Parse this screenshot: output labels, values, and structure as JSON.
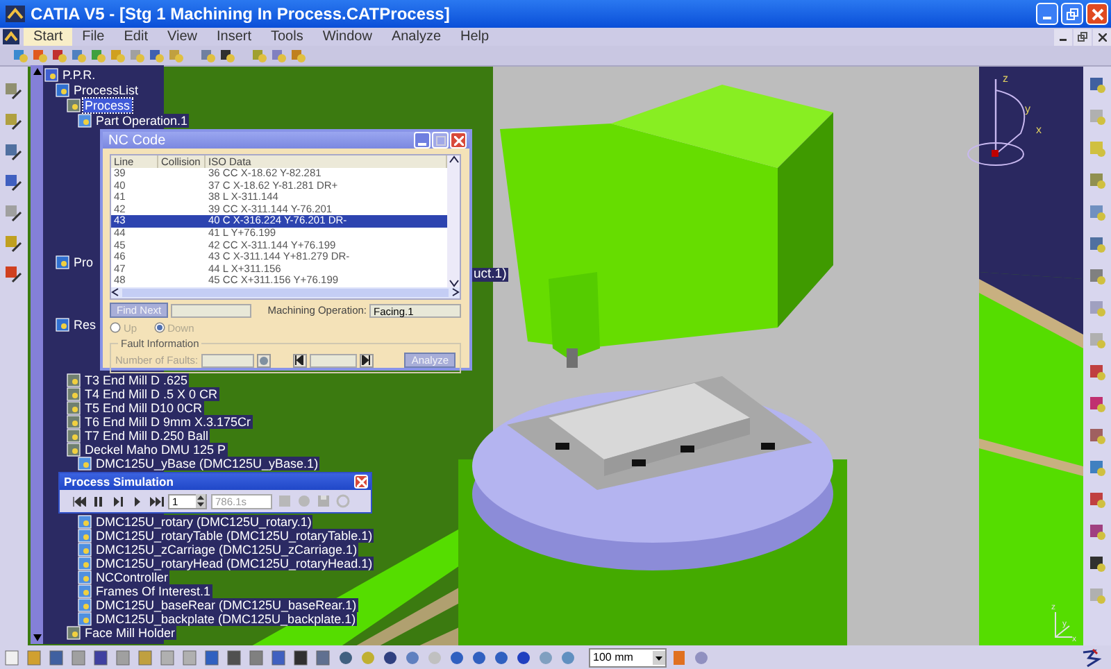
{
  "window": {
    "title": "CATIA V5 - [Stg 1 Machining In Process.CATProcess]"
  },
  "menu": [
    {
      "label": "Start",
      "selected": true
    },
    {
      "label": "File",
      "selected": false
    },
    {
      "label": "Edit",
      "selected": false
    },
    {
      "label": "View",
      "selected": false
    },
    {
      "label": "Insert",
      "selected": false
    },
    {
      "label": "Tools",
      "selected": false
    },
    {
      "label": "Window",
      "selected": false
    },
    {
      "label": "Analyze",
      "selected": false
    },
    {
      "label": "Help",
      "selected": false
    }
  ],
  "tree": {
    "items": [
      {
        "label": "P.P.R.",
        "selected": false,
        "children": [
          {
            "label": "ProcessList",
            "selected": false,
            "children": [
              {
                "label": "Process",
                "selected": true,
                "children": [
                  {
                    "label": "Part Operation.1",
                    "selected": false
                  }
                ]
              }
            ]
          },
          {
            "label": "Pro",
            "selected": false
          },
          {
            "label": "Res",
            "selected": false,
            "children": [
              {
                "label": "T3 End Mill D .625",
                "selected": false
              },
              {
                "label": "T4 End Mill D .5 X 0 CR",
                "selected": false
              },
              {
                "label": "T5 End Mill D10 0CR",
                "selected": false
              },
              {
                "label": "T6 End Mill D 9mm X.3.175Cr",
                "selected": false
              },
              {
                "label": "T7 End Mill D.250 Ball",
                "selected": false
              },
              {
                "label": "Deckel Maho DMU 125 P",
                "selected": false,
                "children": [
                  {
                    "label": "DMC125U_yBase (DMC125U_yBase.1)",
                    "selected": false
                  },
                  {
                    "label": "DMC125U_rotary (DMC125U_rotary.1)",
                    "selected": false
                  },
                  {
                    "label": "DMC125U_rotaryTable (DMC125U_rotaryTable.1)",
                    "selected": false
                  },
                  {
                    "label": "DMC125U_zCarriage (DMC125U_zCarriage.1)",
                    "selected": false
                  },
                  {
                    "label": "DMC125U_rotaryHead (DMC125U_rotaryHead.1)",
                    "selected": false
                  },
                  {
                    "label": "NCController",
                    "selected": false
                  },
                  {
                    "label": "Frames Of Interest.1",
                    "selected": false
                  },
                  {
                    "label": "DMC125U_baseRear (DMC125U_baseRear.1)",
                    "selected": false
                  },
                  {
                    "label": "DMC125U_backplate (DMC125U_backplate.1)",
                    "selected": false
                  }
                ]
              },
              {
                "label": "Face Mill Holder",
                "selected": false
              }
            ]
          }
        ]
      }
    ]
  },
  "tree_fragment": "uct.1)",
  "nc_code": {
    "title": "NC Code",
    "columns": [
      "Line",
      "Collision",
      "ISO Data"
    ],
    "rows": [
      {
        "line": "39",
        "iso": "36 CC X-18.62 Y-82.281",
        "selected": false
      },
      {
        "line": "40",
        "iso": "37 C X-18.62 Y-81.281 DR+",
        "selected": false
      },
      {
        "line": "41",
        "iso": "38 L X-311.144",
        "selected": false
      },
      {
        "line": "42",
        "iso": "39 CC X-311.144 Y-76.201",
        "selected": false
      },
      {
        "line": "43",
        "iso": "40 C X-316.224 Y-76.201 DR-",
        "selected": true
      },
      {
        "line": "44",
        "iso": "41 L Y+76.199",
        "selected": false
      },
      {
        "line": "45",
        "iso": "42 CC X-311.144 Y+76.199",
        "selected": false
      },
      {
        "line": "46",
        "iso": "43 C X-311.144 Y+81.279 DR-",
        "selected": false
      },
      {
        "line": "47",
        "iso": "44 L X+311.156",
        "selected": false
      },
      {
        "line": "48",
        "iso": "45 CC X+311.156 Y+76.199",
        "selected": false
      }
    ],
    "find_button": {
      "label": "Find Next",
      "disabled": true
    },
    "machining_label": "Machining Operation:",
    "machining_value": "Facing.1",
    "direction": [
      {
        "label": "Up",
        "selected": false
      },
      {
        "label": "Down",
        "selected": true
      }
    ],
    "fault_group": "Fault Information",
    "faults_label": "Number of Faults:",
    "analyze_button": {
      "label": "Analyze",
      "disabled": true
    }
  },
  "simulation": {
    "title": "Process Simulation",
    "step": "1",
    "time": "786.1s"
  },
  "bottom_toolbar": {
    "scale": "100 mm"
  },
  "compass": {
    "axes": [
      "z",
      "y",
      "x"
    ]
  },
  "axis_triad": {
    "axes": [
      "z",
      "y",
      "x"
    ]
  }
}
